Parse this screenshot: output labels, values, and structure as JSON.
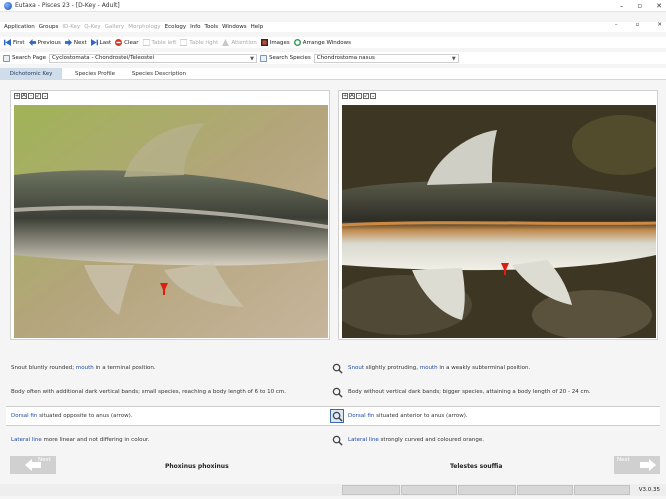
{
  "window": {
    "title": "Eutaxa - Pisces 23 - [D-Key - Adult]"
  },
  "menu": [
    "Application",
    "Groups",
    "ID-Key",
    "Q-Key",
    "Gallery",
    "Morphology",
    "Ecology",
    "Info",
    "Tools",
    "Windows",
    "Help"
  ],
  "menu_disabled": [
    false,
    false,
    true,
    true,
    true,
    true,
    false,
    false,
    false,
    false,
    false
  ],
  "toolbar": {
    "first": "First",
    "previous": "Previous",
    "next": "Next",
    "last": "Last",
    "clear": "Clear",
    "table_left": "Table left",
    "table_right": "Table right",
    "attention": "Attention",
    "images": "Images",
    "arrange": "Arrange Windows"
  },
  "search": {
    "page_label": "Search Page",
    "page_value": "Cyclostomata - Chondrostei/Teleostei",
    "species_label": "Search Species",
    "species_value": "Chondrostoma nasus"
  },
  "tabs": [
    "Dichotomic Key",
    "Species Profile",
    "Species Description"
  ],
  "characters": [
    {
      "left_pre": "Snout bluntly rounded; ",
      "left_link": "mouth",
      "left_post": " in a terminal position.",
      "left_link2": "terminal",
      "right_link": "Snout",
      "right_mid": " slightly protruding, ",
      "right_link2": "mouth",
      "right_post": " in a weakly subterminal position."
    },
    {
      "left": "Body often with additional dark vertical bands; small species, reaching a body length of 6 to 10 cm.",
      "right": "Body without vertical dark bands; bigger species, attaining a body length of 20 - 24 cm."
    },
    {
      "left_link": "Dorsal fin",
      "left_post": " situated opposite to anus (arrow).",
      "right_link": "Dorsal fin",
      "right_post": " situated anterior to anus (arrow)."
    },
    {
      "left_link": "Lateral line",
      "left_post": " more linear and not differing in colour.",
      "right_link": "Lateral line",
      "right_post": " strongly curved and coloured orange."
    }
  ],
  "nav": {
    "prev": "Next",
    "next": "Next",
    "left_species": "Phoxinus phoxinus",
    "right_species": "Telestes souffia"
  },
  "status": {
    "version": "V3.0.35"
  },
  "icons": [
    "app-icon",
    "first-icon",
    "previous-icon",
    "next-icon",
    "last-icon",
    "clear-icon",
    "table-left-icon",
    "table-right-icon",
    "attention-icon",
    "images-icon",
    "arrange-icon",
    "search-icon",
    "magnifier-icon",
    "arrow-left-icon",
    "arrow-right-icon"
  ]
}
